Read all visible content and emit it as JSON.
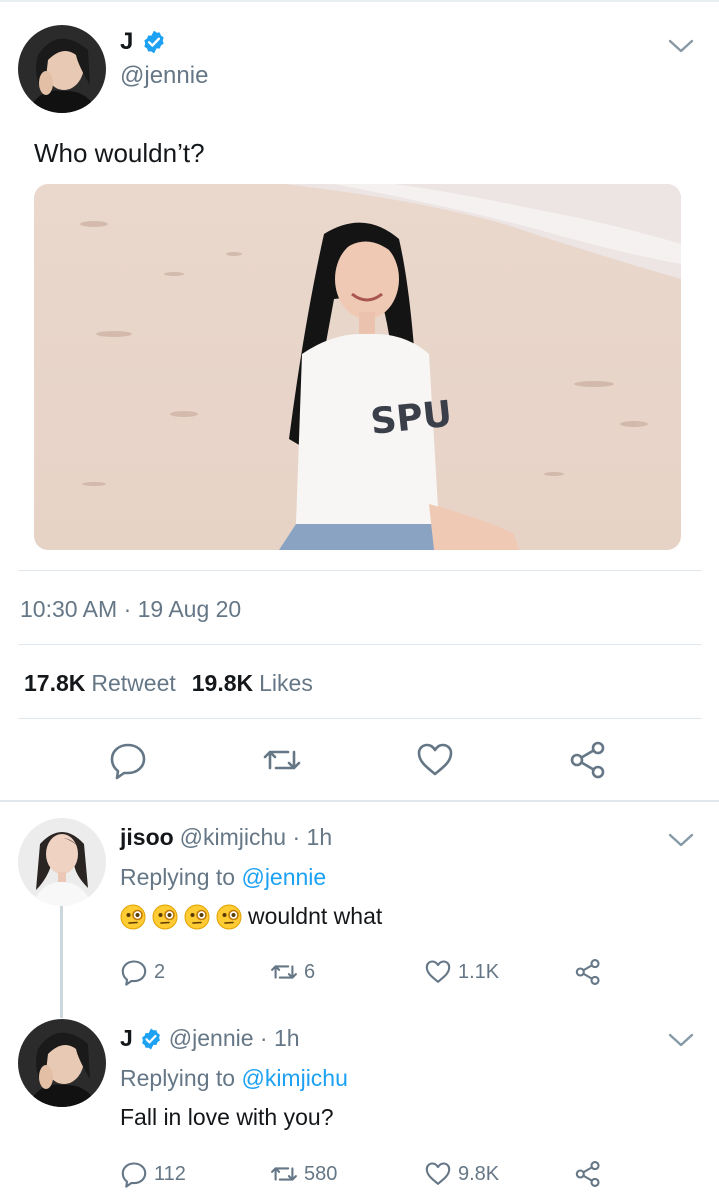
{
  "main_tweet": {
    "author_name": "J",
    "author_handle": "@jennie",
    "text": "Who wouldn’t?",
    "timestamp": "10:30 AM · 19 Aug 20",
    "retweet_count": "17.8K",
    "retweet_label": "Retweet",
    "like_count": "19.8K",
    "like_label": "Likes"
  },
  "replies": [
    {
      "author_name": "jisoo",
      "author_handle": "@kimjichu · 1h",
      "replying_prefix": "Replying to",
      "replying_to": "@jennie",
      "text": "wouldnt what",
      "emojis": [
        "monocle-face",
        "monocle-face",
        "monocle-face",
        "monocle-face"
      ],
      "reply_count": "2",
      "retweet_count": "6",
      "like_count": "1.1K"
    },
    {
      "author_name": "J",
      "author_handle": "@jennie · 1h",
      "replying_prefix": "Replying to",
      "replying_to": "@kimjichu",
      "text": "Fall in love with you?",
      "reply_count": "112",
      "retweet_count": "580",
      "like_count": "9.8K"
    }
  ],
  "icons": [
    "verified-badge-icon",
    "chevron-down-icon",
    "reply-icon",
    "retweet-icon",
    "like-icon",
    "share-icon"
  ],
  "colors": {
    "accent": "#1da1f2",
    "text": "#14171a",
    "secondary": "#657786",
    "divider": "#e1e8ed"
  }
}
